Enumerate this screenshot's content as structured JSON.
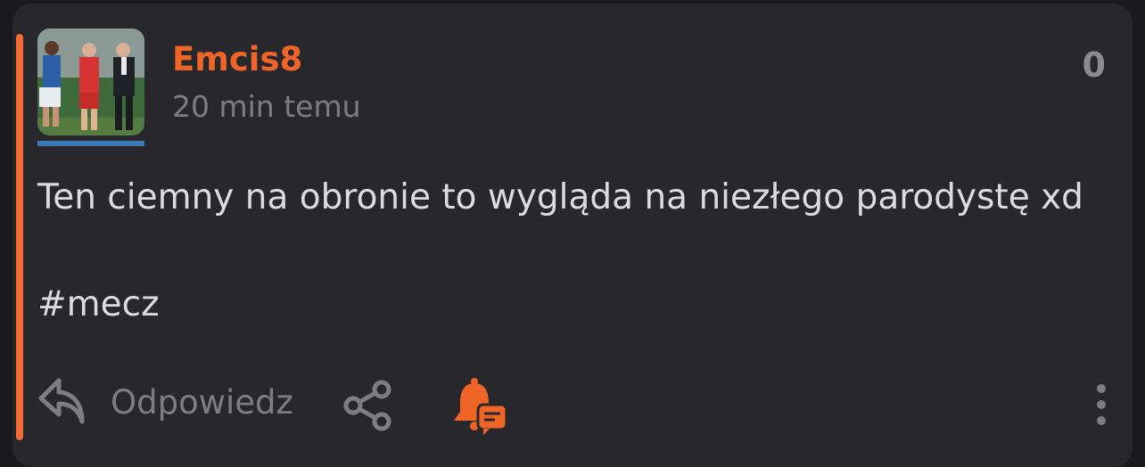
{
  "post": {
    "author": "Emcis8",
    "time": "20 min temu",
    "score": "0",
    "text": "Ten ciemny na obronie to wygląda na niezłego parodystę xd",
    "hashtag": "#mecz"
  },
  "actions": {
    "reply_label": "Odpowiedz"
  },
  "icons": {
    "reply": "reply-arrow-icon",
    "share": "share-icon",
    "notify": "bell-comment-icon",
    "more": "vertical-dots-icon"
  },
  "colors": {
    "accent": "#ef6427",
    "avatar_underline": "#3b7bb5",
    "background": "#28282c"
  }
}
